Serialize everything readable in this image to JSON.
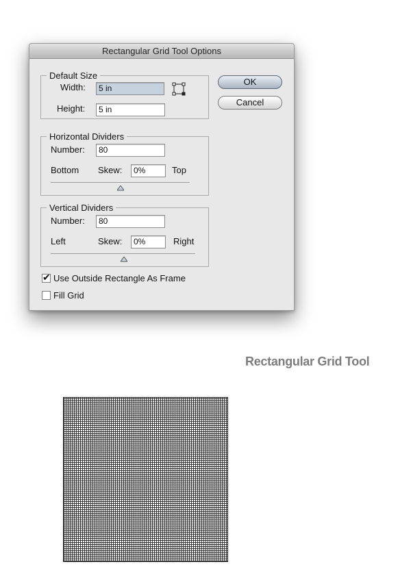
{
  "dialog": {
    "title": "Rectangular Grid Tool Options",
    "default_size": {
      "legend": "Default Size",
      "width_label": "Width:",
      "width_value": "5 in",
      "height_label": "Height:",
      "height_value": "5 in",
      "origin_icon": "grid-origin-icon"
    },
    "horizontal_dividers": {
      "legend": "Horizontal Dividers",
      "number_label": "Number:",
      "number_value": "80",
      "left_label": "Bottom",
      "skew_label": "Skew:",
      "skew_value": "0%",
      "right_label": "Top",
      "slider_value": 0
    },
    "vertical_dividers": {
      "legend": "Vertical Dividers",
      "number_label": "Number:",
      "number_value": "80",
      "left_label": "Left",
      "skew_label": "Skew:",
      "skew_value": "0%",
      "right_label": "Right",
      "slider_value": 0
    },
    "checkboxes": [
      {
        "label": "Use Outside Rectangle As Frame",
        "checked": true
      },
      {
        "label": "Fill Grid",
        "checked": false
      }
    ],
    "buttons": {
      "ok": "OK",
      "cancel": "Cancel"
    }
  },
  "caption": "Rectangular Grid Tool",
  "preview": {
    "rows": 80,
    "columns": 80,
    "line_color": "#333333"
  }
}
